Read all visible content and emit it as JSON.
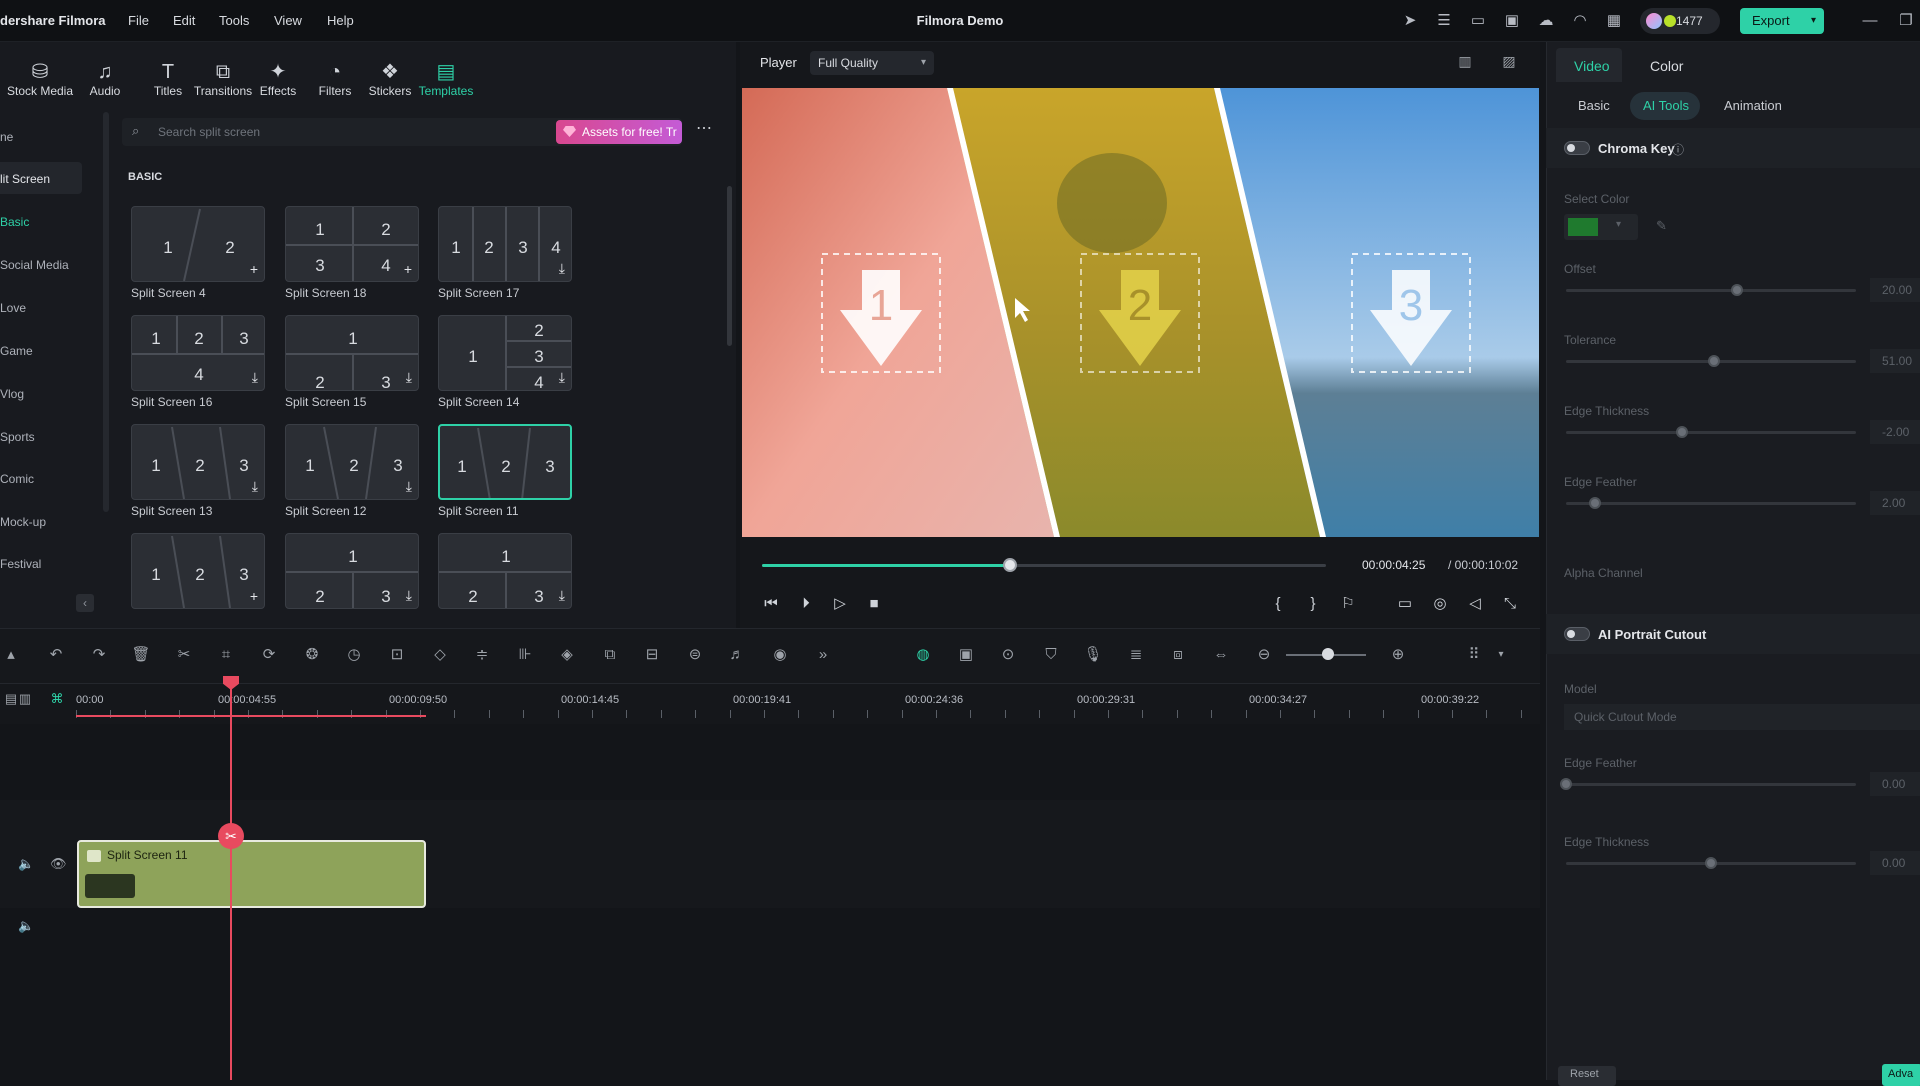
{
  "app": {
    "name": "dershare Filmora",
    "window_title": "Filmora Demo"
  },
  "menu": [
    "File",
    "Edit",
    "Tools",
    "View",
    "Help"
  ],
  "topbar": {
    "credits": "1477",
    "export_label": "Export"
  },
  "library": {
    "tabs": [
      {
        "label": "Stock Media",
        "icon": "stock-media-icon"
      },
      {
        "label": "Audio",
        "icon": "music-note-icon"
      },
      {
        "label": "Titles",
        "icon": "text-t-icon"
      },
      {
        "label": "Transitions",
        "icon": "transitions-icon"
      },
      {
        "label": "Effects",
        "icon": "effects-icon"
      },
      {
        "label": "Filters",
        "icon": "filters-icon"
      },
      {
        "label": "Stickers",
        "icon": "stickers-icon"
      },
      {
        "label": "Templates",
        "icon": "templates-icon"
      }
    ],
    "nav": [
      "ne",
      "lit Screen",
      "Basic",
      "Social Media",
      "Love",
      "Game",
      "Vlog",
      "Sports",
      "Comic",
      "Mock-up",
      "Festival"
    ],
    "search_placeholder": "Search split screen",
    "assets_label": "Assets for free! Tr",
    "section_title": "BASIC",
    "templates": [
      {
        "label": "Split Screen 4"
      },
      {
        "label": "Split Screen 18"
      },
      {
        "label": "Split Screen 17"
      },
      {
        "label": "Split Screen 16"
      },
      {
        "label": "Split Screen 15"
      },
      {
        "label": "Split Screen 14"
      },
      {
        "label": "Split Screen 13"
      },
      {
        "label": "Split Screen 12"
      },
      {
        "label": "Split Screen 11"
      },
      {
        "label": ""
      },
      {
        "label": ""
      },
      {
        "label": ""
      }
    ]
  },
  "player": {
    "label": "Player",
    "quality": "Full Quality",
    "current_time": "00:00:04:25",
    "total_time": "/ 00:00:10:02",
    "progress": 0.44,
    "slot_numbers": [
      "1",
      "2",
      "3"
    ]
  },
  "properties": {
    "tabs": [
      "Video",
      "Color"
    ],
    "subtabs": [
      "Basic",
      "AI Tools",
      "Animation"
    ],
    "chroma_key": {
      "title": "Chroma Key",
      "select_color_label": "Select Color",
      "key_color": "#1f7a2e",
      "params": [
        {
          "label": "Offset",
          "value": "20.00",
          "level": 0.59
        },
        {
          "label": "Tolerance",
          "value": "51.00",
          "level": 0.51
        },
        {
          "label": "Edge Thickness",
          "value": "-2.00",
          "level": 0.4
        },
        {
          "label": "Edge Feather",
          "value": "2.00",
          "level": 0.1
        }
      ],
      "alpha_channel_label": "Alpha Channel"
    },
    "ai_portrait": {
      "title": "AI Portrait Cutout",
      "model_label": "Model",
      "model_value": "Quick Cutout Mode",
      "params": [
        {
          "label": "Edge Feather",
          "value": "0.00",
          "level": 0.0
        },
        {
          "label": "Edge Thickness",
          "value": "0.00",
          "level": 0.5
        }
      ]
    },
    "reset_label": "Reset",
    "advanced_label": "Adva"
  },
  "timeline": {
    "ruler": [
      "00:00",
      "00:00:04:55",
      "00:00:09:50",
      "00:00:14:45",
      "00:00:19:41",
      "00:00:24:36",
      "00:00:29:31",
      "00:00:34:27",
      "00:00:39:22"
    ],
    "clip_label": "Split Screen 11"
  },
  "colors": {
    "accent": "#2ed1a7",
    "playhead": "#e84a5f",
    "clip": "#8ea35a"
  }
}
